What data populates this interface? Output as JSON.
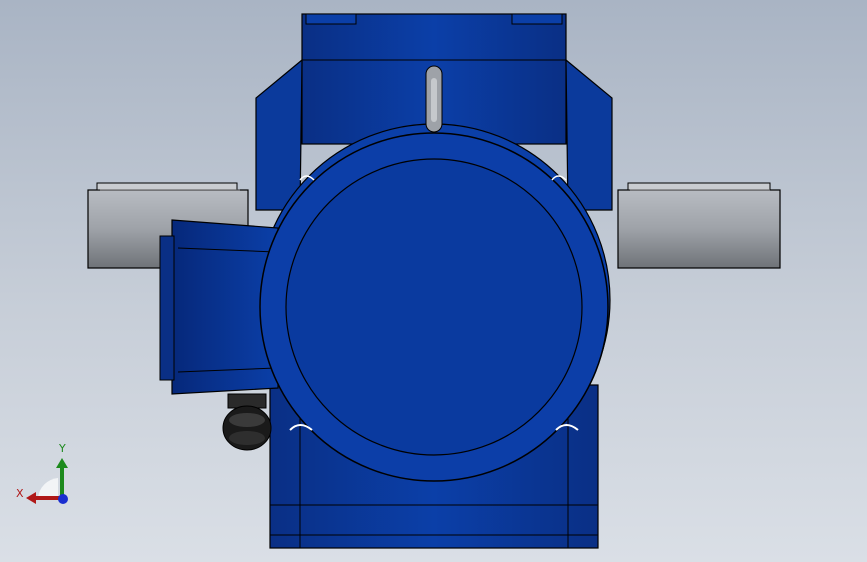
{
  "viewport": {
    "background_top": "#a9b4c4",
    "background_bottom": "#dadfe6"
  },
  "model": {
    "body_color": "#0a3aa0",
    "edge_color": "#000000",
    "shaft_color": "#9ea2a8"
  },
  "triad": {
    "x_label": "X",
    "y_label": "Y",
    "x_color": "#b01818",
    "y_color": "#1d8a1d",
    "z_color": "#1a2ed0"
  }
}
